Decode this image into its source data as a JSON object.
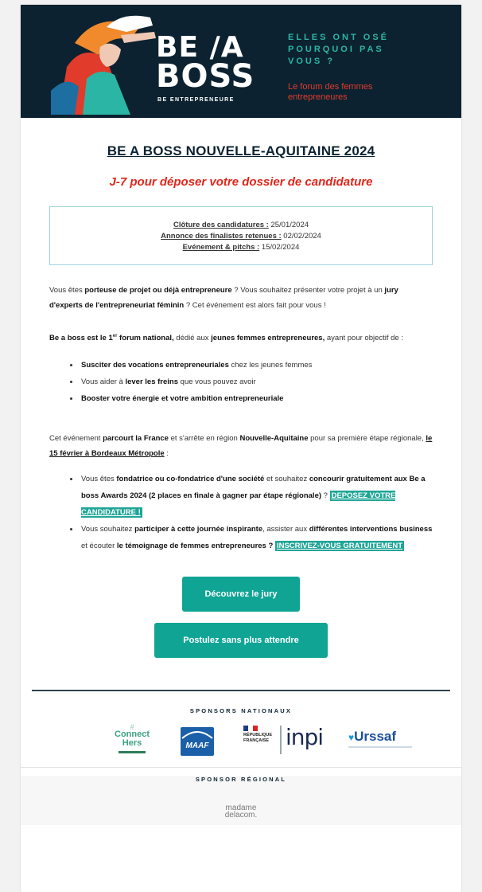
{
  "header": {
    "logo_line1": "BE /A",
    "logo_line2": "BOSS",
    "logo_sub": "BE ENTREPRENEURE",
    "tagline": [
      "ELLES ONT OSÉ",
      "POURQUOI PAS",
      "VOUS ?"
    ],
    "tagline_sub": "Le forum des femmes entrepreneures",
    "colors": {
      "background": "#0c2230",
      "teal": "#2bb5a4",
      "red": "#e03b2b"
    }
  },
  "title": "BE A BOSS NOUVELLE-AQUITAINE 2024",
  "subtitle": "J-7 pour déposer votre dossier de candidature",
  "dates": [
    {
      "label": "Clôture des candidatures :",
      "value": " 25/01/2024"
    },
    {
      "label": "Annonce des finalistes retenues :",
      "value": " 02/02/2024"
    },
    {
      "label": "Evénement & pitchs :",
      "value": " 15/02/2024"
    }
  ],
  "para1": {
    "t1": "Vous êtes ",
    "b1": "porteuse de projet ou déjà entrepreneure",
    "t2": " ? Vous souhaitez présenter votre projet à un ",
    "b2": "jury d'experts de l'entrepreneuriat féminin",
    "t3": " ? Cet événement est alors fait pour vous !"
  },
  "para2": {
    "b1": "Be a boss est le 1",
    "sup": "er",
    "b2": " forum national,",
    "t1": " dédié aux ",
    "b3": "jeunes femmes entrepreneures,",
    "t2": " ayant pour objectif de :"
  },
  "list1": [
    {
      "b": "Susciter des vocations entrepreneuriales",
      "t": " chez les jeunes femmes",
      "pre": ""
    },
    {
      "pre": "Vous aider à ",
      "b": "lever les freins",
      "t": " que vous pouvez avoir"
    },
    {
      "pre": "",
      "b": "Booster votre énergie et votre ambition entrepreneuriale",
      "t": ""
    }
  ],
  "para3": {
    "t1": "Cet événement ",
    "b1": "parcourt la France",
    "t2": " et s'arrête en région ",
    "b2": "Nouvelle-Aquitaine",
    "t3": " pour sa première étape régionale, ",
    "b3": "le 15 février à Bordeaux Métropole",
    "t4": " :"
  },
  "list2": [
    {
      "t1": "Vous êtes ",
      "b1": "fondatrice ou co-fondatrice d'une société",
      "t2": " et souhaitez ",
      "b2": "concourir gratuitement aux Be a boss Awards 2024 (2 places en finale à gagner par étape régionale)",
      "t3": " ? ",
      "link": "DEPOSEZ VOTRE CANDIDATURE !"
    },
    {
      "t1": "Vous souhaitez ",
      "b1": "participer à cette journée inspirante",
      "t2": ", assister aux ",
      "b2": "différentes interventions business",
      "t3": " et écouter ",
      "b3": "le témoignage de femmes entrepreneures ?",
      "link": "INSCRIVEZ-VOUS GRATUITEMENT"
    }
  ],
  "buttons": {
    "jury": "Découvrez le jury",
    "apply": "Postulez sans plus attendre",
    "color": "#10a495"
  },
  "sponsors": {
    "national_title": "SPONSORS NATIONAUX",
    "regional_title": "SPONSOR RÉGIONAL",
    "connect": "Connect",
    "hers": "Hers",
    "maaf": "MAAF",
    "republique": [
      "RÉPUBLIQUE",
      "FRANÇAISE"
    ],
    "inpi": "inpi",
    "urssaf": "Urssaf",
    "madame1": "madame",
    "madame2": "delacom."
  }
}
